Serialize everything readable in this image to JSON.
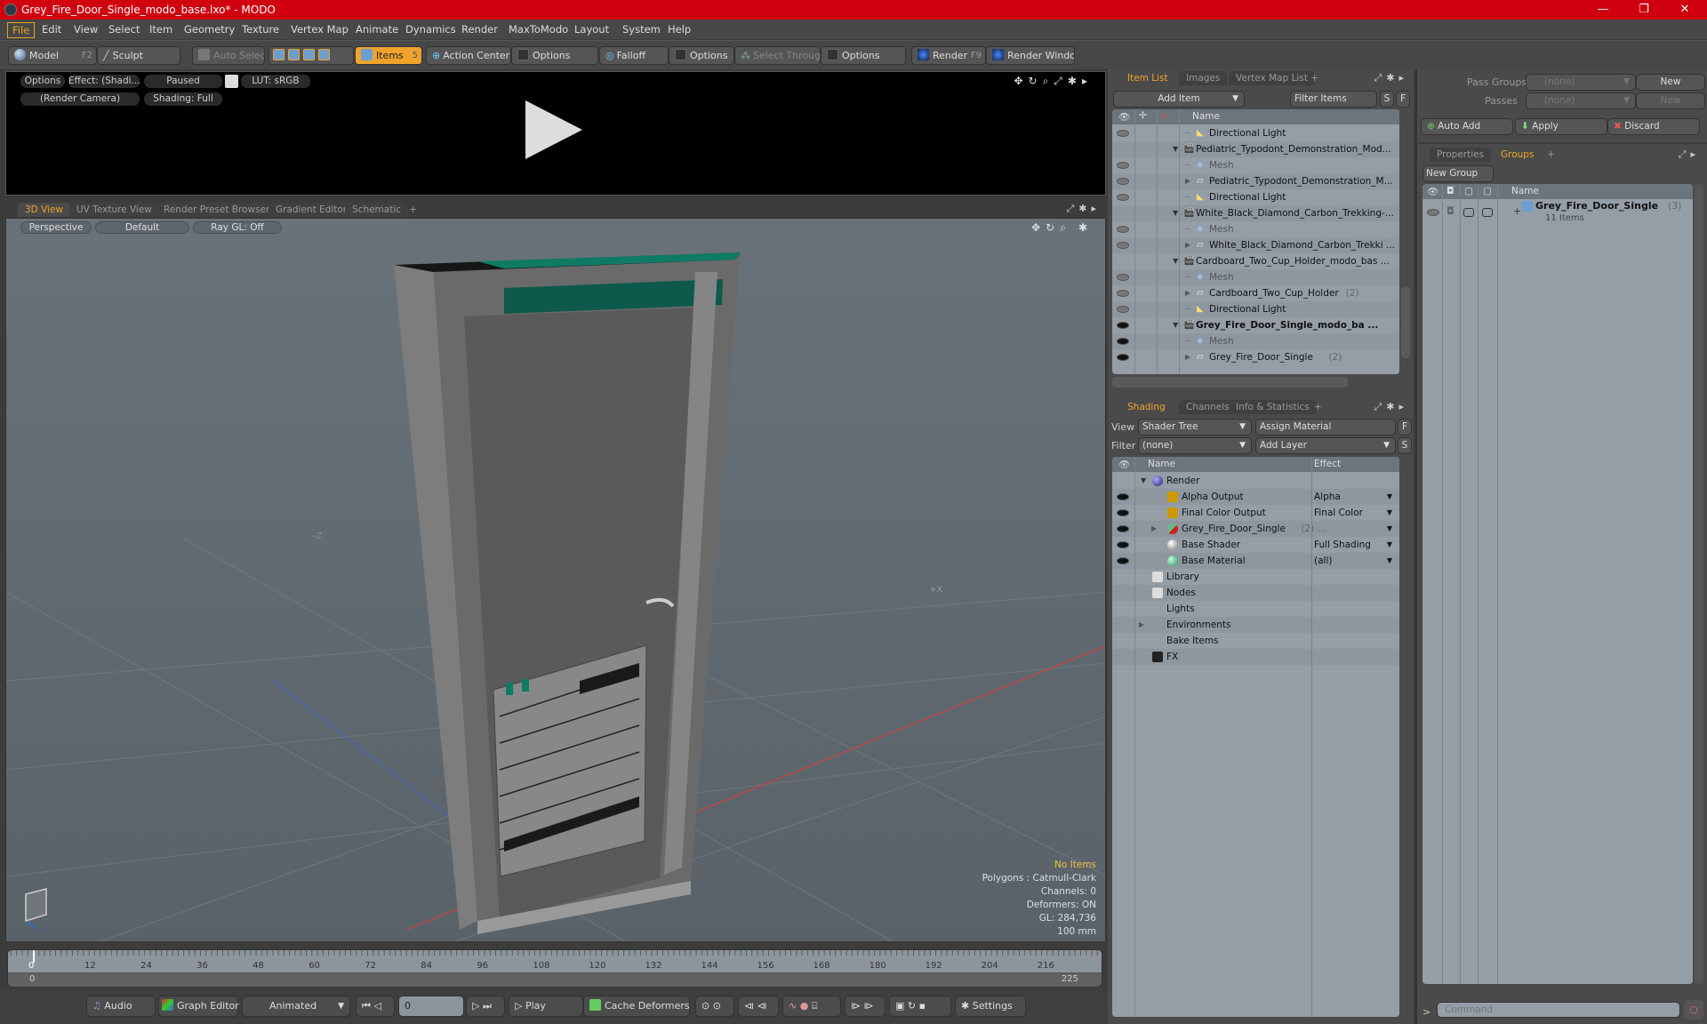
{
  "window": {
    "title": "Grey_Fire_Door_Single_modo_base.lxo* - MODO",
    "controls": [
      "minimize-icon",
      "restore-icon",
      "close-icon"
    ]
  },
  "menu": [
    "File",
    "Edit",
    "View",
    "Select",
    "Item",
    "Geometry",
    "Texture",
    "Vertex Map",
    "Animate",
    "Dynamics",
    "Render",
    "MaxToModo",
    "Layout",
    "System",
    "Help"
  ],
  "toolbar": {
    "model": "Model",
    "model_key": "F2",
    "sculpt": "Sculpt",
    "auto_select": "Auto Select",
    "items": "Items",
    "items_count": "5",
    "action_center": "Action Center",
    "options1": "Options",
    "falloff": "Falloff",
    "options2": "Options",
    "select_through": "Select Through",
    "options3": "Options",
    "render": "Render",
    "render_key": "F9",
    "render_window": "Render Window"
  },
  "render_view": {
    "options": "Options",
    "effect": "Effect: (Shadi...",
    "paused": "Paused",
    "lut": "LUT: sRGB",
    "camera": "(Render Camera)",
    "shading": "Shading: Full"
  },
  "view_tabs": [
    "3D View",
    "UV Texture View",
    "Render Preset Browser",
    "Gradient Editor",
    "Schematic",
    "+"
  ],
  "viewport": {
    "projection": "Perspective",
    "style": "Default",
    "raygl": "Ray GL: Off",
    "axis_labels": {
      "z": "-Z",
      "x": "+X"
    },
    "info": {
      "items": "No Items",
      "polygons": "Polygons : Catmull-Clark",
      "channels": "Channels: 0",
      "deformers": "Deformers: ON",
      "gl": "GL: 284,736",
      "scale": "100 mm"
    }
  },
  "timeline": {
    "ticks": [
      "0",
      "12",
      "24",
      "36",
      "48",
      "60",
      "72",
      "84",
      "96",
      "108",
      "120",
      "132",
      "144",
      "156",
      "168",
      "180",
      "192",
      "204",
      "216"
    ],
    "start": "0",
    "end": "225",
    "current": "0"
  },
  "transport": {
    "audio": "Audio",
    "graph_editor": "Graph Editor",
    "animated": "Animated",
    "frame": "0",
    "play": "Play",
    "cache_deformers": "Cache Deformers",
    "settings": "Settings"
  },
  "item_list": {
    "tabs": [
      "Item List",
      "Images",
      "Vertex Map List",
      "+"
    ],
    "add_item": "Add Item",
    "filter": "Filter Items",
    "s": "S",
    "f": "F",
    "col_name": "Name",
    "rows": [
      {
        "label": "Directional Light",
        "indent": 2,
        "type": "light",
        "eye": "gray"
      },
      {
        "label": "Pediatric_Typodont_Demonstration_Mod...",
        "indent": 1,
        "type": "scene",
        "eye": "none"
      },
      {
        "label": "Mesh",
        "indent": 2,
        "type": "mesh",
        "eye": "gray"
      },
      {
        "label": "Pediatric_Typodont_Demonstration_M...",
        "indent": 2,
        "type": "group",
        "eye": "gray"
      },
      {
        "label": "Directional Light",
        "indent": 2,
        "type": "light",
        "eye": "gray"
      },
      {
        "label": "White_Black_Diamond_Carbon_Trekking-...",
        "indent": 1,
        "type": "scene",
        "eye": "none"
      },
      {
        "label": "Mesh",
        "indent": 2,
        "type": "mesh",
        "eye": "gray"
      },
      {
        "label": "White_Black_Diamond_Carbon_Trekki ...",
        "indent": 2,
        "type": "group",
        "eye": "gray"
      },
      {
        "label": "Cardboard_Two_Cup_Holder_modo_bas ...",
        "indent": 1,
        "type": "scene",
        "eye": "none"
      },
      {
        "label": "Mesh",
        "indent": 2,
        "type": "mesh",
        "eye": "gray"
      },
      {
        "label": "Cardboard_Two_Cup_Holder",
        "count": "(2)",
        "indent": 2,
        "type": "group",
        "eye": "gray"
      },
      {
        "label": "Directional Light",
        "indent": 2,
        "type": "light",
        "eye": "gray"
      },
      {
        "label": "Grey_Fire_Door_Single_modo_ba ...",
        "indent": 1,
        "type": "scene",
        "eye": "dark",
        "bold": true
      },
      {
        "label": "Mesh",
        "indent": 2,
        "type": "mesh",
        "eye": "dark"
      },
      {
        "label": "Grey_Fire_Door_Single",
        "count": "(2)",
        "indent": 2,
        "type": "group",
        "eye": "dark"
      }
    ]
  },
  "shading": {
    "tabs": [
      "Shading",
      "Channels",
      "Info & Statistics",
      "+"
    ],
    "view_label": "View",
    "view_value": "Shader Tree",
    "assign_material": "Assign Material",
    "filter_label": "Filter",
    "filter_value": "(none)",
    "add_layer": "Add Layer",
    "f": "F",
    "s": "S",
    "col_name": "Name",
    "col_effect": "Effect",
    "rows": [
      {
        "label": "Render",
        "effect": "",
        "indent": 0,
        "icon": "render-sphere",
        "eye": false
      },
      {
        "label": "Alpha Output",
        "effect": "Alpha",
        "indent": 1,
        "icon": "output",
        "eye": true
      },
      {
        "label": "Final Color Output",
        "effect": "Final Color",
        "indent": 1,
        "icon": "output",
        "eye": true
      },
      {
        "label": "Grey_Fire_Door_Single",
        "count": "(2) ...",
        "effect": "",
        "indent": 1,
        "icon": "material-group",
        "eye": true
      },
      {
        "label": "Base Shader",
        "effect": "Full Shading",
        "indent": 1,
        "icon": "shader",
        "eye": true
      },
      {
        "label": "Base Material",
        "effect": "(all)",
        "indent": 1,
        "icon": "material",
        "eye": true
      },
      {
        "label": "Library",
        "effect": "",
        "indent": 0,
        "icon": "folder",
        "eye": false
      },
      {
        "label": "Nodes",
        "effect": "",
        "indent": 0,
        "icon": "folder",
        "eye": false
      },
      {
        "label": "Lights",
        "effect": "",
        "indent": 0,
        "icon": "",
        "eye": false
      },
      {
        "label": "Environments",
        "effect": "",
        "indent": 0,
        "icon": "",
        "eye": false
      },
      {
        "label": "Bake Items",
        "effect": "",
        "indent": 0,
        "icon": "",
        "eye": false
      },
      {
        "label": "FX",
        "effect": "",
        "indent": 0,
        "icon": "clapper",
        "eye": false
      }
    ]
  },
  "passes": {
    "pass_groups_label": "Pass Groups",
    "pass_groups_value": "(none)",
    "new1": "New",
    "passes_label": "Passes",
    "passes_value": "(none)",
    "new2": "New",
    "auto_add": "Auto Add",
    "apply": "Apply",
    "discard": "Discard"
  },
  "groups": {
    "tabs": [
      "Properties",
      "Groups",
      "+"
    ],
    "new_group": "New Group",
    "col_name": "Name",
    "item": {
      "label": "Grey_Fire_Door_Single",
      "count": "(3)",
      "suffix": ": ...",
      "sub": "11 Items"
    }
  },
  "command": {
    "prompt": ">",
    "placeholder": "Command"
  }
}
